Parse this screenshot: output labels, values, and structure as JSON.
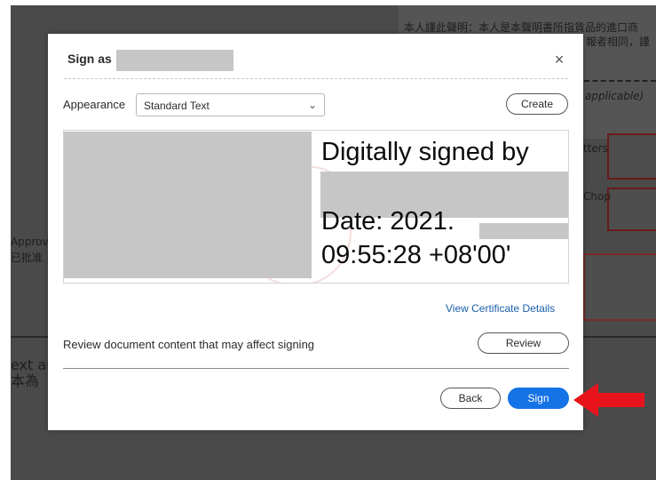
{
  "background": {
    "text_top_1": "本人謹此聲明：本人是本聲明書所指貨品的進口商",
    "text_top_2": "報者相同，謹",
    "text_applicable": "applicable)",
    "text_letters": "tters",
    "text_chop": "Chop",
    "text_approv": "Approv",
    "text_approv_cn": "已批准",
    "text_ext": "ext ar",
    "text_ext_cn": "本為"
  },
  "dialog": {
    "title": "Sign as",
    "close_symbol": "×",
    "appearance_label": "Appearance",
    "appearance_value": "Standard Text",
    "chevron_symbol": "⌄",
    "create_label": "Create",
    "signature": {
      "line1": "Digitally signed by",
      "line2": "Date: 2021.",
      "line3": "09:55:28 +08'00'"
    },
    "view_cert_label": "View Certificate Details",
    "review_prompt": "Review document content that may affect signing",
    "review_label": "Review",
    "back_label": "Back",
    "sign_label": "Sign"
  },
  "colors": {
    "accent": "#1473e6",
    "link": "#1a5fa8",
    "arrow": "#e8141c",
    "redaction": "#c6c6c6"
  },
  "icons": {
    "close": "close-icon",
    "chevron": "chevron-down-icon",
    "arrow": "red-arrow-annotation"
  }
}
